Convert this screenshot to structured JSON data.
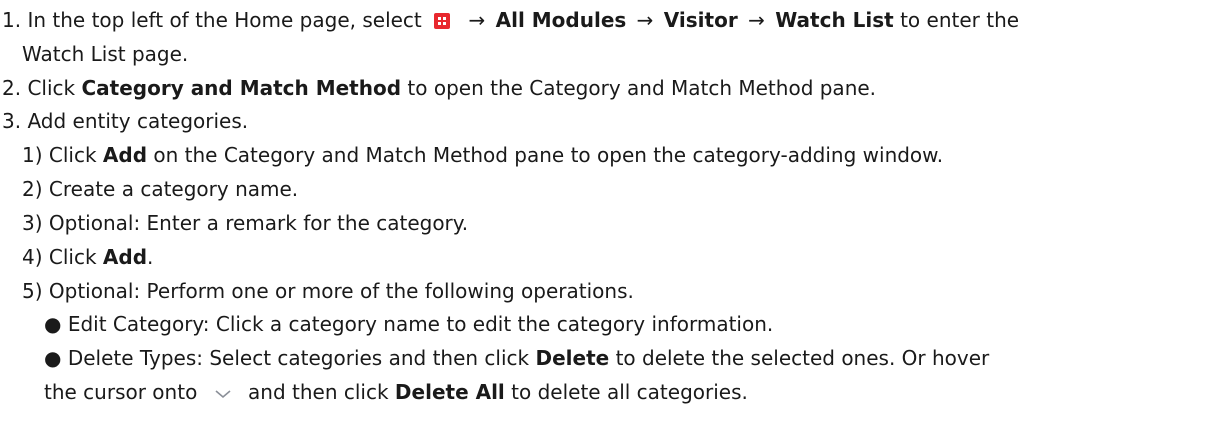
{
  "steps": {
    "s1": {
      "num": "1.",
      "pre": "In the top left of the Home page, select",
      "arrow": "→",
      "m1": "All Modules",
      "m2": "Visitor",
      "m3": "Watch List",
      "post": "to enter the",
      "cont": "Watch List page."
    },
    "s2": {
      "num": "2.",
      "pre": "Click",
      "b": "Category and Match Method",
      "post": "to open the Category and Match Method pane."
    },
    "s3": {
      "num": "3.",
      "text": "Add entity categories."
    },
    "sub1": {
      "num": "1)",
      "pre": "Click",
      "b": "Add",
      "post": "on the Category and Match Method pane to open the category-adding window."
    },
    "sub2": {
      "num": "2)",
      "text": "Create a category name."
    },
    "sub3": {
      "num": "3)",
      "text": "Optional: Enter a remark for the category."
    },
    "sub4": {
      "num": "4)",
      "pre": "Click",
      "b": "Add",
      "post": "."
    },
    "sub5": {
      "num": "5)",
      "text": "Optional: Perform one or more of the following operations."
    },
    "bul1": {
      "dot": "●",
      "text": "Edit Category: Click a category name to edit the category information."
    },
    "bul2": {
      "dot": "●",
      "pre": "Delete Types: Select categories and then click",
      "b": "Delete",
      "post": "to delete the selected ones. Or hover",
      "cont_pre": "the cursor onto",
      "cont_mid": "and then click",
      "cont_b": "Delete All",
      "cont_post": "to delete all categories."
    }
  },
  "icons": {
    "app_menu": "app-grid-icon",
    "dropdown": "chevron-down-icon",
    "app_menu_color": "#e8282e"
  }
}
